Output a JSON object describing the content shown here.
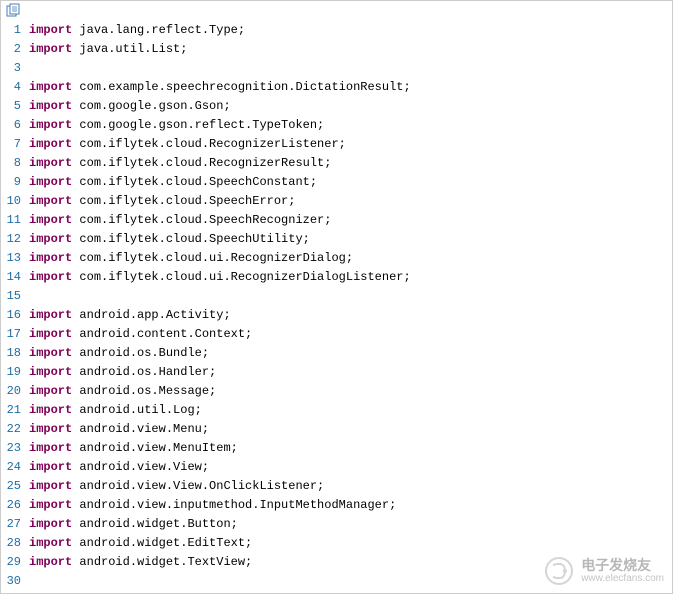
{
  "code": {
    "lines": [
      {
        "n": 1,
        "kw": "import",
        "rest": " java.lang.reflect.Type;"
      },
      {
        "n": 2,
        "kw": "import",
        "rest": " java.util.List;"
      },
      {
        "n": 3,
        "kw": "",
        "rest": ""
      },
      {
        "n": 4,
        "kw": "import",
        "rest": " com.example.speechrecognition.DictationResult;"
      },
      {
        "n": 5,
        "kw": "import",
        "rest": " com.google.gson.Gson;"
      },
      {
        "n": 6,
        "kw": "import",
        "rest": " com.google.gson.reflect.TypeToken;"
      },
      {
        "n": 7,
        "kw": "import",
        "rest": " com.iflytek.cloud.RecognizerListener;"
      },
      {
        "n": 8,
        "kw": "import",
        "rest": " com.iflytek.cloud.RecognizerResult;"
      },
      {
        "n": 9,
        "kw": "import",
        "rest": " com.iflytek.cloud.SpeechConstant;"
      },
      {
        "n": 10,
        "kw": "import",
        "rest": " com.iflytek.cloud.SpeechError;"
      },
      {
        "n": 11,
        "kw": "import",
        "rest": " com.iflytek.cloud.SpeechRecognizer;"
      },
      {
        "n": 12,
        "kw": "import",
        "rest": " com.iflytek.cloud.SpeechUtility;"
      },
      {
        "n": 13,
        "kw": "import",
        "rest": " com.iflytek.cloud.ui.RecognizerDialog;"
      },
      {
        "n": 14,
        "kw": "import",
        "rest": " com.iflytek.cloud.ui.RecognizerDialogListener;"
      },
      {
        "n": 15,
        "kw": "",
        "rest": ""
      },
      {
        "n": 16,
        "kw": "import",
        "rest": " android.app.Activity;"
      },
      {
        "n": 17,
        "kw": "import",
        "rest": " android.content.Context;"
      },
      {
        "n": 18,
        "kw": "import",
        "rest": " android.os.Bundle;"
      },
      {
        "n": 19,
        "kw": "import",
        "rest": " android.os.Handler;"
      },
      {
        "n": 20,
        "kw": "import",
        "rest": " android.os.Message;"
      },
      {
        "n": 21,
        "kw": "import",
        "rest": " android.util.Log;"
      },
      {
        "n": 22,
        "kw": "import",
        "rest": " android.view.Menu;"
      },
      {
        "n": 23,
        "kw": "import",
        "rest": " android.view.MenuItem;"
      },
      {
        "n": 24,
        "kw": "import",
        "rest": " android.view.View;"
      },
      {
        "n": 25,
        "kw": "import",
        "rest": " android.view.View.OnClickListener;"
      },
      {
        "n": 26,
        "kw": "import",
        "rest": " android.view.inputmethod.InputMethodManager;"
      },
      {
        "n": 27,
        "kw": "import",
        "rest": " android.widget.Button;"
      },
      {
        "n": 28,
        "kw": "import",
        "rest": " android.widget.EditText;"
      },
      {
        "n": 29,
        "kw": "import",
        "rest": " android.widget.TextView;"
      },
      {
        "n": 30,
        "kw": "",
        "rest": ""
      }
    ]
  },
  "watermark": {
    "title": "电子发烧友",
    "url": "www.elecfans.com"
  }
}
